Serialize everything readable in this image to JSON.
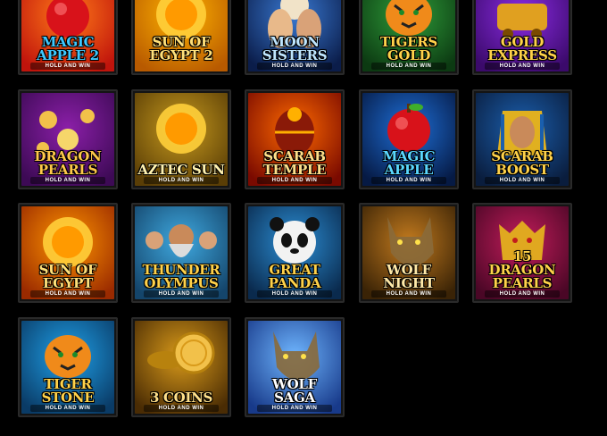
{
  "games": [
    {
      "title": "MAGIC APPLE 2",
      "subtitle": "HOLD AND WIN",
      "colors": [
        "#ff7a18",
        "#c0140c"
      ],
      "text": "#3ec8ff",
      "icon": "apple-icon"
    },
    {
      "title": "SUN OF EGYPT 2",
      "subtitle": "",
      "colors": [
        "#ffb300",
        "#b85a00"
      ],
      "text": "#ffe07a",
      "icon": "sun-icon"
    },
    {
      "title": "MOON SISTERS",
      "subtitle": "HOLD AND WIN",
      "colors": [
        "#3a7bd5",
        "#0b1d4a"
      ],
      "text": "#bfe6ff",
      "icon": "moon-icon"
    },
    {
      "title": "TIGERS GOLD",
      "subtitle": "HOLD AND WIN",
      "colors": [
        "#2f9e3a",
        "#0c3a12"
      ],
      "text": "#ffd24a",
      "icon": "tiger-icon"
    },
    {
      "title": "GOLD EXPRESS",
      "subtitle": "HOLD AND WIN",
      "colors": [
        "#8a2be2",
        "#3b0a6b"
      ],
      "text": "#ffd24a",
      "icon": "train-icon"
    },
    {
      "title": "DRAGON PEARLS",
      "subtitle": "HOLD AND WIN",
      "colors": [
        "#8b1fa8",
        "#3d0a55"
      ],
      "text": "#ffc84a",
      "icon": "pearl-icon"
    },
    {
      "title": "AZTEC SUN",
      "subtitle": "HOLD AND WIN",
      "colors": [
        "#c79a1e",
        "#5a3e06"
      ],
      "text": "#fff2b0",
      "icon": "sun-disc-icon"
    },
    {
      "title": "SCARAB TEMPLE",
      "subtitle": "HOLD AND WIN",
      "colors": [
        "#ff6a00",
        "#7a0a00"
      ],
      "text": "#ffe08a",
      "icon": "scarab-icon"
    },
    {
      "title": "MAGIC APPLE",
      "subtitle": "HOLD AND WIN",
      "colors": [
        "#1e6fd8",
        "#061a44"
      ],
      "text": "#5ad8ff",
      "icon": "apple-icon"
    },
    {
      "title": "SCARAB BOOST",
      "subtitle": "HOLD AND WIN",
      "colors": [
        "#1b5fae",
        "#0a1d3d"
      ],
      "text": "#ffd24a",
      "icon": "pharaoh-icon"
    },
    {
      "title": "SUN OF EGYPT",
      "subtitle": "HOLD AND WIN",
      "colors": [
        "#ff9500",
        "#9a2a00"
      ],
      "text": "#ffe07a",
      "icon": "sun-icon"
    },
    {
      "title": "THUNDER OLYMPUS",
      "subtitle": "HOLD AND WIN",
      "colors": [
        "#3fa9e0",
        "#14456b"
      ],
      "text": "#ffd24a",
      "icon": "zeus-icon"
    },
    {
      "title": "GREAT PANDA",
      "subtitle": "HOLD AND WIN",
      "colors": [
        "#2c8fd6",
        "#0a2a4d"
      ],
      "text": "#ffd24a",
      "icon": "panda-icon"
    },
    {
      "title": "WOLF NIGHT",
      "subtitle": "HOLD AND WIN",
      "colors": [
        "#c27a1e",
        "#3a2306"
      ],
      "text": "#ffe9a8",
      "icon": "wolf-icon"
    },
    {
      "title": "15 DRAGON PEARLS",
      "subtitle": "HOLD AND WIN",
      "colors": [
        "#c21c5a",
        "#4a0726"
      ],
      "text": "#ffd24a",
      "icon": "dragon-icon"
    },
    {
      "title": "TIGER STONE",
      "subtitle": "HOLD AND WIN",
      "colors": [
        "#1fa0e8",
        "#0a3b66"
      ],
      "text": "#ffd24a",
      "icon": "tiger-icon"
    },
    {
      "title": "3 COINS",
      "subtitle": "HOLD AND WIN",
      "colors": [
        "#d99a1a",
        "#4a2c04"
      ],
      "text": "#ffe08a",
      "icon": "coin-icon"
    },
    {
      "title": "WOLF SAGA",
      "subtitle": "HOLD AND WIN",
      "colors": [
        "#6fb6ff",
        "#183a8a"
      ],
      "text": "#ffffff",
      "icon": "wolf-icon"
    }
  ]
}
